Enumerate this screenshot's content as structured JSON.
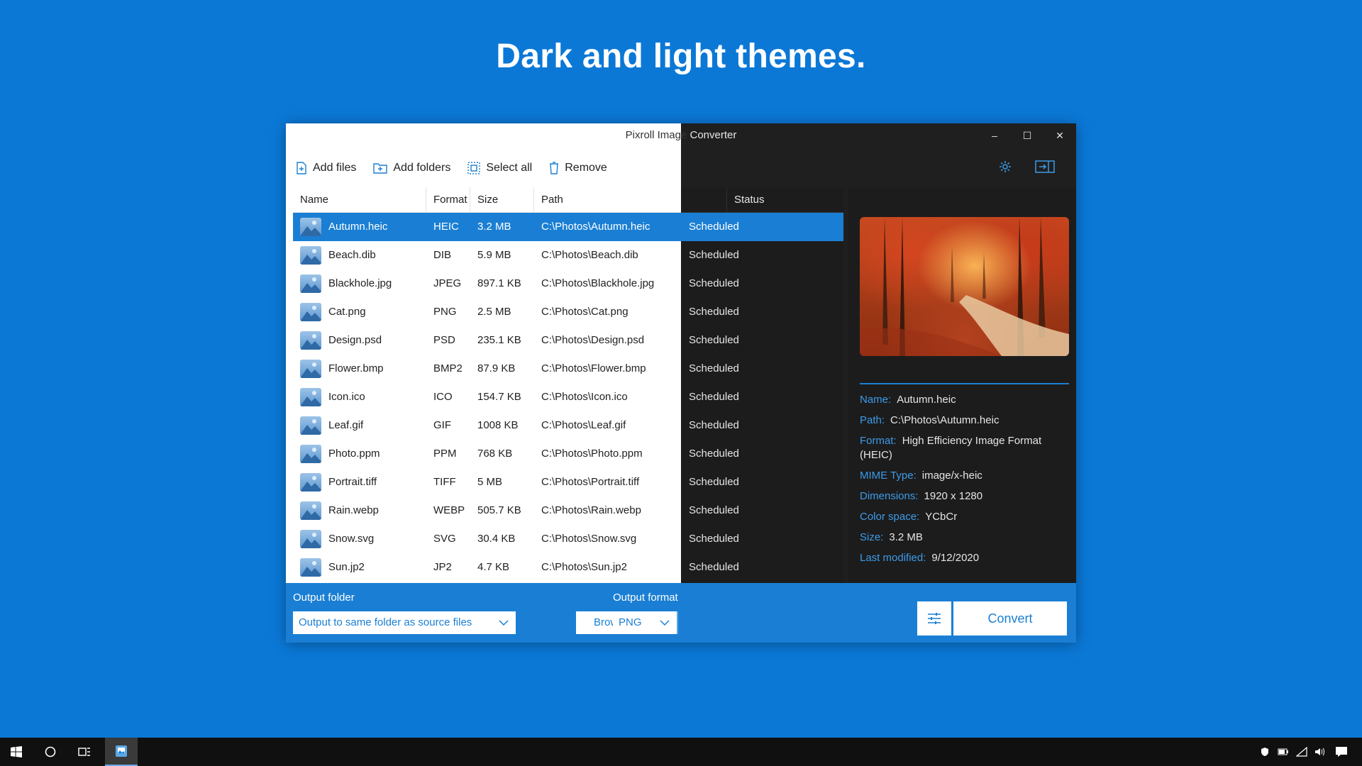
{
  "headline": "Dark and light themes.",
  "window": {
    "title_light": "Pixroll Image",
    "title_dark": " Converter",
    "controls": {
      "minimize": "–",
      "maximize": "☐",
      "close": "✕"
    }
  },
  "toolbar": {
    "add_files": "Add files",
    "add_folders": "Add folders",
    "select_all": "Select all",
    "remove": "Remove"
  },
  "table": {
    "columns": {
      "name": "Name",
      "format": "Format",
      "size": "Size",
      "path": "Path",
      "status": "Status"
    },
    "rows": [
      {
        "name": "Autumn.heic",
        "format": "HEIC",
        "size": "3.2 MB",
        "path": "C:\\Photos\\Autumn.heic",
        "status": "Scheduled"
      },
      {
        "name": "Beach.dib",
        "format": "DIB",
        "size": "5.9 MB",
        "path": "C:\\Photos\\Beach.dib",
        "status": "Scheduled"
      },
      {
        "name": "Blackhole.jpg",
        "format": "JPEG",
        "size": "897.1 KB",
        "path": "C:\\Photos\\Blackhole.jpg",
        "status": "Scheduled"
      },
      {
        "name": "Cat.png",
        "format": "PNG",
        "size": "2.5 MB",
        "path": "C:\\Photos\\Cat.png",
        "status": "Scheduled"
      },
      {
        "name": "Design.psd",
        "format": "PSD",
        "size": "235.1 KB",
        "path": "C:\\Photos\\Design.psd",
        "status": "Scheduled"
      },
      {
        "name": "Flower.bmp",
        "format": "BMP2",
        "size": "87.9 KB",
        "path": "C:\\Photos\\Flower.bmp",
        "status": "Scheduled"
      },
      {
        "name": "Icon.ico",
        "format": "ICO",
        "size": "154.7 KB",
        "path": "C:\\Photos\\Icon.ico",
        "status": "Scheduled"
      },
      {
        "name": "Leaf.gif",
        "format": "GIF",
        "size": "1008 KB",
        "path": "C:\\Photos\\Leaf.gif",
        "status": "Scheduled"
      },
      {
        "name": "Photo.ppm",
        "format": "PPM",
        "size": "768 KB",
        "path": "C:\\Photos\\Photo.ppm",
        "status": "Scheduled"
      },
      {
        "name": "Portrait.tiff",
        "format": "TIFF",
        "size": "5 MB",
        "path": "C:\\Photos\\Portrait.tiff",
        "status": "Scheduled"
      },
      {
        "name": "Rain.webp",
        "format": "WEBP",
        "size": "505.7 KB",
        "path": "C:\\Photos\\Rain.webp",
        "status": "Scheduled"
      },
      {
        "name": "Snow.svg",
        "format": "SVG",
        "size": "30.4 KB",
        "path": "C:\\Photos\\Snow.svg",
        "status": "Scheduled"
      },
      {
        "name": "Sun.jp2",
        "format": "JP2",
        "size": "4.7 KB",
        "path": "C:\\Photos\\Sun.jp2",
        "status": "Scheduled"
      }
    ]
  },
  "preview": {
    "props": [
      {
        "key": "Name:",
        "value": "Autumn.heic"
      },
      {
        "key": "Path:",
        "value": "C:\\Photos\\Autumn.heic"
      },
      {
        "key": "Format:",
        "value": "High Efficiency Image Format (HEIC)"
      },
      {
        "key": "MIME Type:",
        "value": "image/x-heic"
      },
      {
        "key": "Dimensions:",
        "value": "1920 x 1280"
      },
      {
        "key": "Color space:",
        "value": "YCbCr"
      },
      {
        "key": "Size:",
        "value": "3.2 MB"
      },
      {
        "key": "Last modified:",
        "value": "9/12/2020"
      }
    ]
  },
  "bottom": {
    "output_folder_label": "Output folder",
    "output_folder_value": "Output to same folder as source files",
    "browse": "Browse",
    "output_format_label": "Output format",
    "output_format_value": "PNG",
    "convert": "Convert"
  },
  "colors": {
    "background": "#0b78d6",
    "accent": "#1a7fd4",
    "dark_panel": "#1c1c1c",
    "window_dark": "#1f1f1f"
  },
  "icons": [
    "add-file-icon",
    "add-folder-icon",
    "select-all-icon",
    "trash-icon",
    "gear-icon",
    "sidebar-toggle-icon",
    "image-file-icon",
    "chevron-down-icon",
    "folder-icon",
    "sliders-icon",
    "windows-start-icon",
    "cortana-icon",
    "task-view-icon",
    "app-icon"
  ]
}
